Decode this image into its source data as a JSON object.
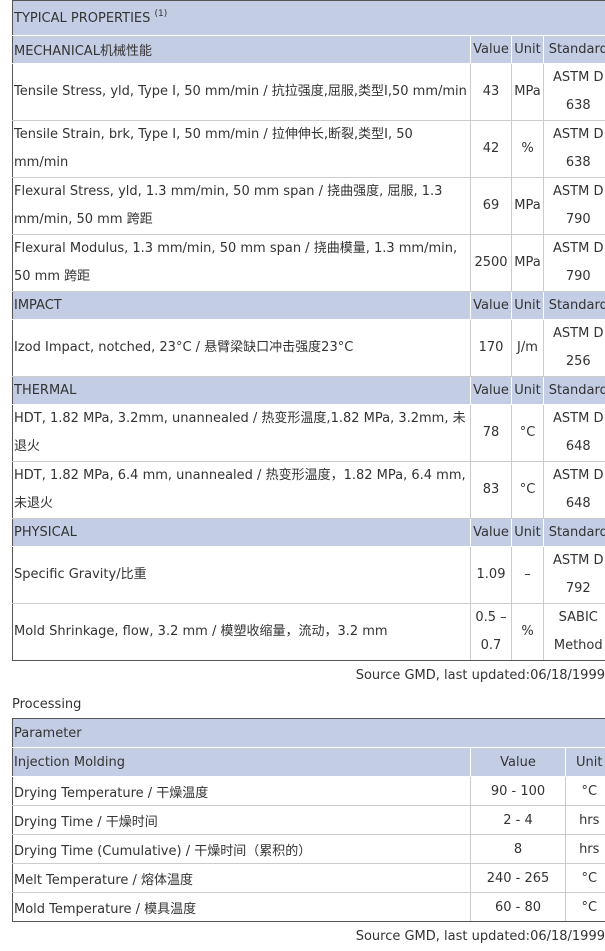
{
  "typical_properties": {
    "title": "TYPICAL PROPERTIES",
    "footnote": "(1)",
    "sections": [
      {
        "name": "MECHANICAL机械性能",
        "col_value": "Value",
        "col_unit": "Unit",
        "col_standard": "Standard",
        "rows": [
          {
            "name": "Tensile Stress, yld, Type I, 50 mm/min / 抗拉强度,屈服,类型I,50 mm/min",
            "value": "43",
            "unit": "MPa",
            "standard": "ASTM D 638"
          },
          {
            "name": "Tensile Strain, brk, Type I, 50 mm/min / 拉伸伸长,断裂,类型I, 50 mm/min",
            "value": "42",
            "unit": "%",
            "standard": "ASTM D 638"
          },
          {
            "name": "Flexural Stress, yld, 1.3 mm/min, 50 mm span / 挠曲强度, 屈服, 1.3 mm/min, 50 mm 跨距",
            "value": "69",
            "unit": "MPa",
            "standard": "ASTM D 790"
          },
          {
            "name": "Flexural Modulus, 1.3 mm/min, 50 mm span / 挠曲模量, 1.3 mm/min, 50 mm 跨距",
            "value": "2500",
            "unit": "MPa",
            "standard": "ASTM D 790"
          }
        ]
      },
      {
        "name": "IMPACT",
        "col_value": "Value",
        "col_unit": "Unit",
        "col_standard": "Standard",
        "rows": [
          {
            "name": "Izod Impact, notched, 23°C / 悬臂梁缺口冲击强度23°C",
            "value": "170",
            "unit": "J/m",
            "standard": "ASTM D 256"
          }
        ]
      },
      {
        "name": "THERMAL",
        "col_value": "Value",
        "col_unit": "Unit",
        "col_standard": "Standard",
        "rows": [
          {
            "name": "HDT, 1.82 MPa, 3.2mm, unannealed / 热变形温度,1.82 MPa, 3.2mm, 未退火",
            "value": "78",
            "unit": "°C",
            "standard": "ASTM D 648"
          },
          {
            "name": "HDT, 1.82 MPa, 6.4 mm, unannealed / 热变形温度，1.82 MPa, 6.4 mm, 未退火",
            "value": "83",
            "unit": "°C",
            "standard": "ASTM D 648"
          }
        ]
      },
      {
        "name": "PHYSICAL",
        "col_value": "Value",
        "col_unit": "Unit",
        "col_standard": "Standard",
        "rows": [
          {
            "name": "Specific Gravity/比重",
            "value": "1.09",
            "unit": "–",
            "standard": "ASTM D 792"
          },
          {
            "name": "Mold Shrinkage, flow, 3.2 mm / 模塑收缩量，流动，3.2 mm",
            "value": "0.5 – 0.7",
            "unit": "%",
            "standard": "SABIC Method"
          }
        ]
      }
    ],
    "source": "Source GMD, last updated:06/18/1999"
  },
  "processing": {
    "title": "Processing",
    "header": "Parameter",
    "section": {
      "name": "Injection Molding",
      "col_value": "Value",
      "col_unit": "Unit"
    },
    "rows": [
      {
        "name": "Drying Temperature / 干燥温度",
        "value": "90 - 100",
        "unit": "°C"
      },
      {
        "name": "Drying Time / 干燥时间",
        "value": "2 - 4",
        "unit": "hrs"
      },
      {
        "name": "Drying Time (Cumulative) / 干燥时间（累积的）",
        "value": "8",
        "unit": "hrs"
      },
      {
        "name": "Melt Temperature / 熔体温度",
        "value": "240 - 265",
        "unit": "°C"
      },
      {
        "name": "Mold Temperature / 模具温度",
        "value": "60 - 80",
        "unit": "°C"
      }
    ],
    "source": "Source GMD, last updated:06/18/1999"
  }
}
